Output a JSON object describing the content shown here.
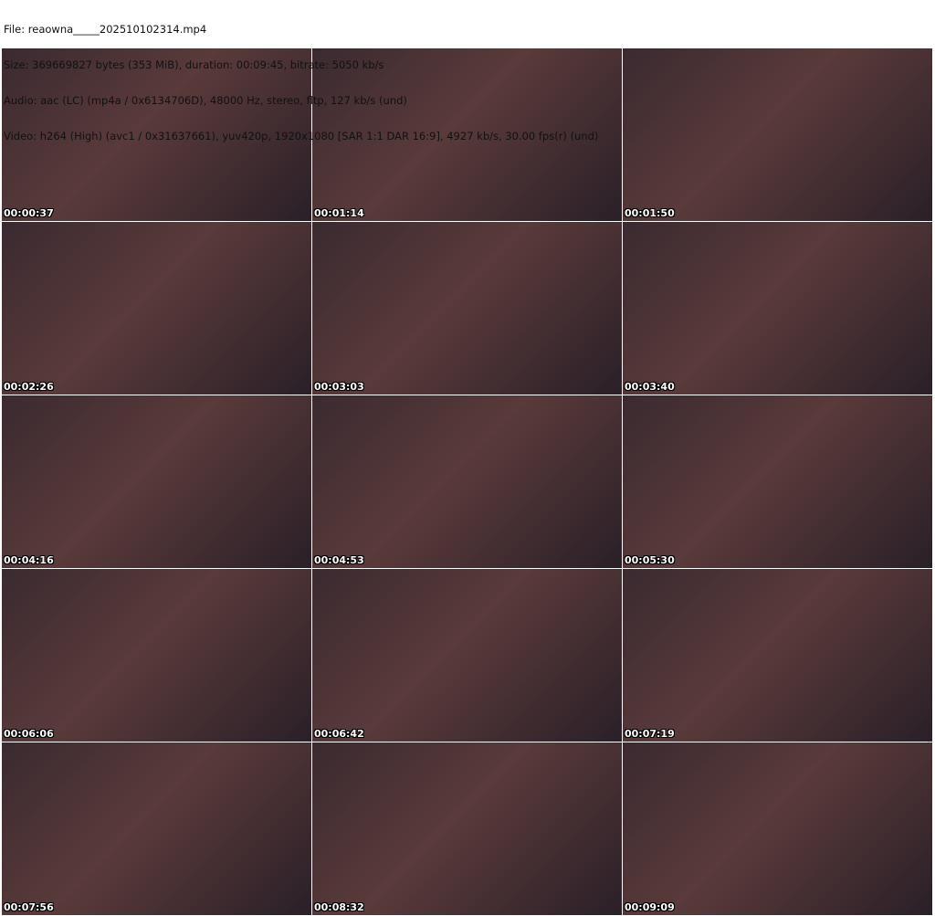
{
  "header": {
    "file": "File: reaowna_____202510102314.mp4",
    "size": "Size: 369669827 bytes (353 MiB), duration: 00:09:45, bitrate: 5050 kb/s",
    "audio": "Audio: aac (LC) (mp4a / 0x6134706D), 48000 Hz, stereo, fltp, 127 kb/s (und)",
    "video": "Video: h264 (High) (avc1 / 0x31637661), yuv420p, 1920x1080 [SAR 1:1 DAR 16:9], 4927 kb/s, 30.00 fps(r) (und)"
  },
  "thumbnails": [
    "00:00:37",
    "00:01:14",
    "00:01:50",
    "00:02:26",
    "00:03:03",
    "00:03:40",
    "00:04:16",
    "00:04:53",
    "00:05:30",
    "00:06:06",
    "00:06:42",
    "00:07:19",
    "00:07:56",
    "00:08:32",
    "00:09:09"
  ]
}
